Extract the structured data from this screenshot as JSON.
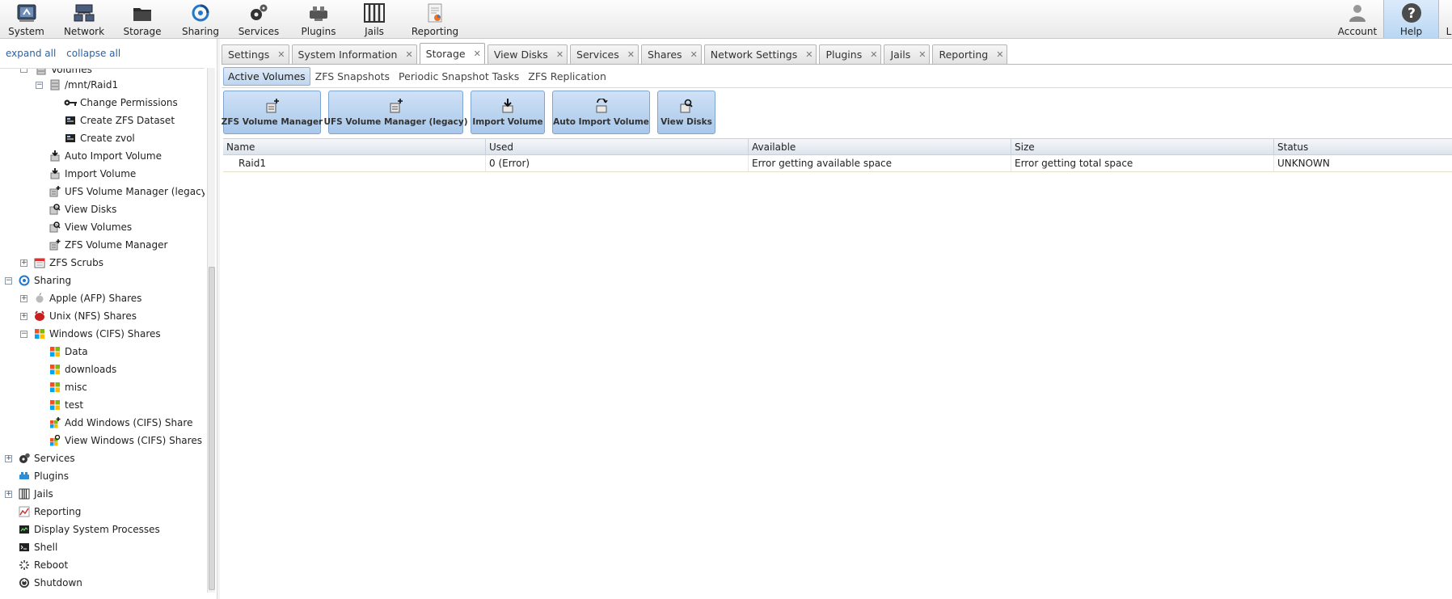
{
  "toolbar": {
    "items": [
      {
        "label": "System",
        "icon": "system-icon"
      },
      {
        "label": "Network",
        "icon": "network-icon"
      },
      {
        "label": "Storage",
        "icon": "storage-icon"
      },
      {
        "label": "Sharing",
        "icon": "sharing-icon"
      },
      {
        "label": "Services",
        "icon": "services-icon"
      },
      {
        "label": "Plugins",
        "icon": "plugins-icon"
      },
      {
        "label": "Jails",
        "icon": "jails-icon"
      },
      {
        "label": "Reporting",
        "icon": "reporting-icon"
      }
    ],
    "account_label": "Account",
    "help_label": "Help",
    "logout_partial": "L"
  },
  "tree": {
    "expand_all": "expand all",
    "collapse_all": "collapse all",
    "nodes": [
      {
        "label": "Volumes",
        "icon": "volume-icon"
      },
      {
        "label": "/mnt/Raid1",
        "icon": "volume-icon"
      },
      {
        "label": "Change Permissions",
        "icon": "key-icon"
      },
      {
        "label": "Create ZFS Dataset",
        "icon": "dataset-icon"
      },
      {
        "label": "Create zvol",
        "icon": "zvol-icon"
      },
      {
        "label": "Auto Import Volume",
        "icon": "auto-import-icon"
      },
      {
        "label": "Import Volume",
        "icon": "import-icon"
      },
      {
        "label": "UFS Volume Manager (legacy)",
        "icon": "volume-add-icon"
      },
      {
        "label": "View Disks",
        "icon": "view-disks-icon"
      },
      {
        "label": "View Volumes",
        "icon": "view-volumes-icon"
      },
      {
        "label": "ZFS Volume Manager",
        "icon": "volume-add-icon"
      },
      {
        "label": "ZFS Scrubs",
        "icon": "calendar-icon"
      },
      {
        "label": "Sharing",
        "icon": "sharing-icon"
      },
      {
        "label": "Apple (AFP) Shares",
        "icon": "apple-icon"
      },
      {
        "label": "Unix (NFS) Shares",
        "icon": "unix-icon"
      },
      {
        "label": "Windows (CIFS) Shares",
        "icon": "windows-icon"
      },
      {
        "label": "Data",
        "icon": "windows-icon"
      },
      {
        "label": "downloads",
        "icon": "windows-icon"
      },
      {
        "label": "misc",
        "icon": "windows-icon"
      },
      {
        "label": "test",
        "icon": "windows-icon"
      },
      {
        "label": "Add Windows (CIFS) Share",
        "icon": "windows-add-icon"
      },
      {
        "label": "View Windows (CIFS) Shares",
        "icon": "windows-view-icon"
      },
      {
        "label": "Services",
        "icon": "services-icon"
      },
      {
        "label": "Plugins",
        "icon": "plugins-icon"
      },
      {
        "label": "Jails",
        "icon": "jails-icon"
      },
      {
        "label": "Reporting",
        "icon": "reporting-icon"
      },
      {
        "label": "Display System Processes",
        "icon": "processes-icon"
      },
      {
        "label": "Shell",
        "icon": "shell-icon"
      },
      {
        "label": "Reboot",
        "icon": "reboot-icon"
      },
      {
        "label": "Shutdown",
        "icon": "shutdown-icon"
      }
    ]
  },
  "tabs": [
    {
      "label": "Settings"
    },
    {
      "label": "System Information"
    },
    {
      "label": "Storage"
    },
    {
      "label": "View Disks"
    },
    {
      "label": "Services"
    },
    {
      "label": "Shares"
    },
    {
      "label": "Network Settings"
    },
    {
      "label": "Plugins"
    },
    {
      "label": "Jails"
    },
    {
      "label": "Reporting"
    }
  ],
  "subtabs": [
    "Active Volumes",
    "ZFS Snapshots",
    "Periodic Snapshot Tasks",
    "ZFS Replication"
  ],
  "actions": [
    {
      "label": "ZFS Volume Manager",
      "icon": "volume-add-icon"
    },
    {
      "label": "UFS Volume Manager (legacy)",
      "icon": "volume-add-icon"
    },
    {
      "label": "Import Volume",
      "icon": "import-icon"
    },
    {
      "label": "Auto Import Volume",
      "icon": "auto-import-icon"
    },
    {
      "label": "View Disks",
      "icon": "view-disks-icon"
    }
  ],
  "grid": {
    "columns": [
      "Name",
      "Used",
      "Available",
      "Size",
      "Status"
    ],
    "rows": [
      [
        "Raid1",
        "0 (Error)",
        "Error getting available space",
        "Error getting total space",
        "UNKNOWN"
      ]
    ]
  },
  "colors": {
    "link": "#2a62a8",
    "active_blue": "#bfd6ef",
    "button_blue": "#a9c8eb"
  }
}
